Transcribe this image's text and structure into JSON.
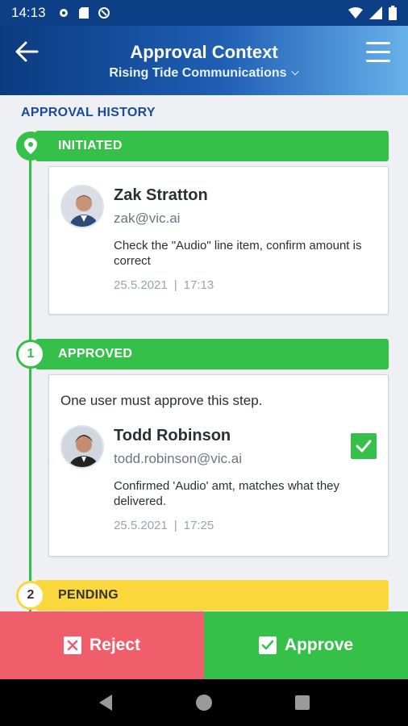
{
  "status_bar": {
    "time": "14:13"
  },
  "header": {
    "title": "Approval Context",
    "subtitle": "Rising Tide Communications"
  },
  "section_title": "APPROVAL HISTORY",
  "steps": [
    {
      "label": "INITIATED",
      "status": "initiated",
      "entry": {
        "name": "Zak Stratton",
        "email": "zak@vic.ai",
        "comment": "Check the \"Audio\" line item, confirm amount is correct",
        "date": "25.5.2021",
        "time": "17:13"
      }
    },
    {
      "label": "APPROVED",
      "number": "1",
      "status": "approved",
      "rule": "One user must approve this step.",
      "entry": {
        "name": "Todd Robinson",
        "email": "todd.robinson@vic.ai",
        "comment": "Confirmed 'Audio' amt, matches what they delivered.",
        "date": "25.5.2021",
        "time": "17:25"
      }
    },
    {
      "label": "PENDING",
      "number": "2",
      "status": "pending"
    }
  ],
  "actions": {
    "reject_label": "Reject",
    "approve_label": "Approve"
  },
  "colors": {
    "header_start": "#0b3a80",
    "header_end": "#67b1ea",
    "green": "#35c04a",
    "pending_yellow": "#fad73a",
    "reject_red": "#f05d6b"
  },
  "icons": [
    "back-arrow-icon",
    "hamburger-menu-icon",
    "chevron-down-icon",
    "location-pin-icon",
    "checkmark-icon",
    "close-box-icon",
    "check-box-icon",
    "nav-back-icon",
    "nav-home-icon",
    "nav-recents-icon"
  ]
}
